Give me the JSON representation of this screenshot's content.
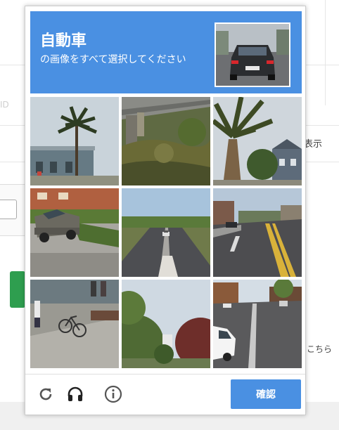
{
  "background": {
    "id_label": "ID",
    "display_label": "表示",
    "here_label": "こちら"
  },
  "captcha": {
    "target": "自動車",
    "instruction": "の画像をすべて選択してください",
    "tiles": [
      {
        "icon": "palm-tree-house"
      },
      {
        "icon": "bridge-overgrowth"
      },
      {
        "icon": "palm-trunk-house"
      },
      {
        "icon": "pickup-truck"
      },
      {
        "icon": "road-with-car"
      },
      {
        "icon": "street-intersection"
      },
      {
        "icon": "sidewalk-bicycle"
      },
      {
        "icon": "trees-sky"
      },
      {
        "icon": "street-white-car"
      }
    ],
    "buttons": {
      "reload_icon": "reload-icon",
      "audio_icon": "headphones-icon",
      "info_icon": "info-icon",
      "verify_label": "確認"
    },
    "colors": {
      "accent": "#4a90e2",
      "background_button": "#2e9e4f"
    }
  }
}
